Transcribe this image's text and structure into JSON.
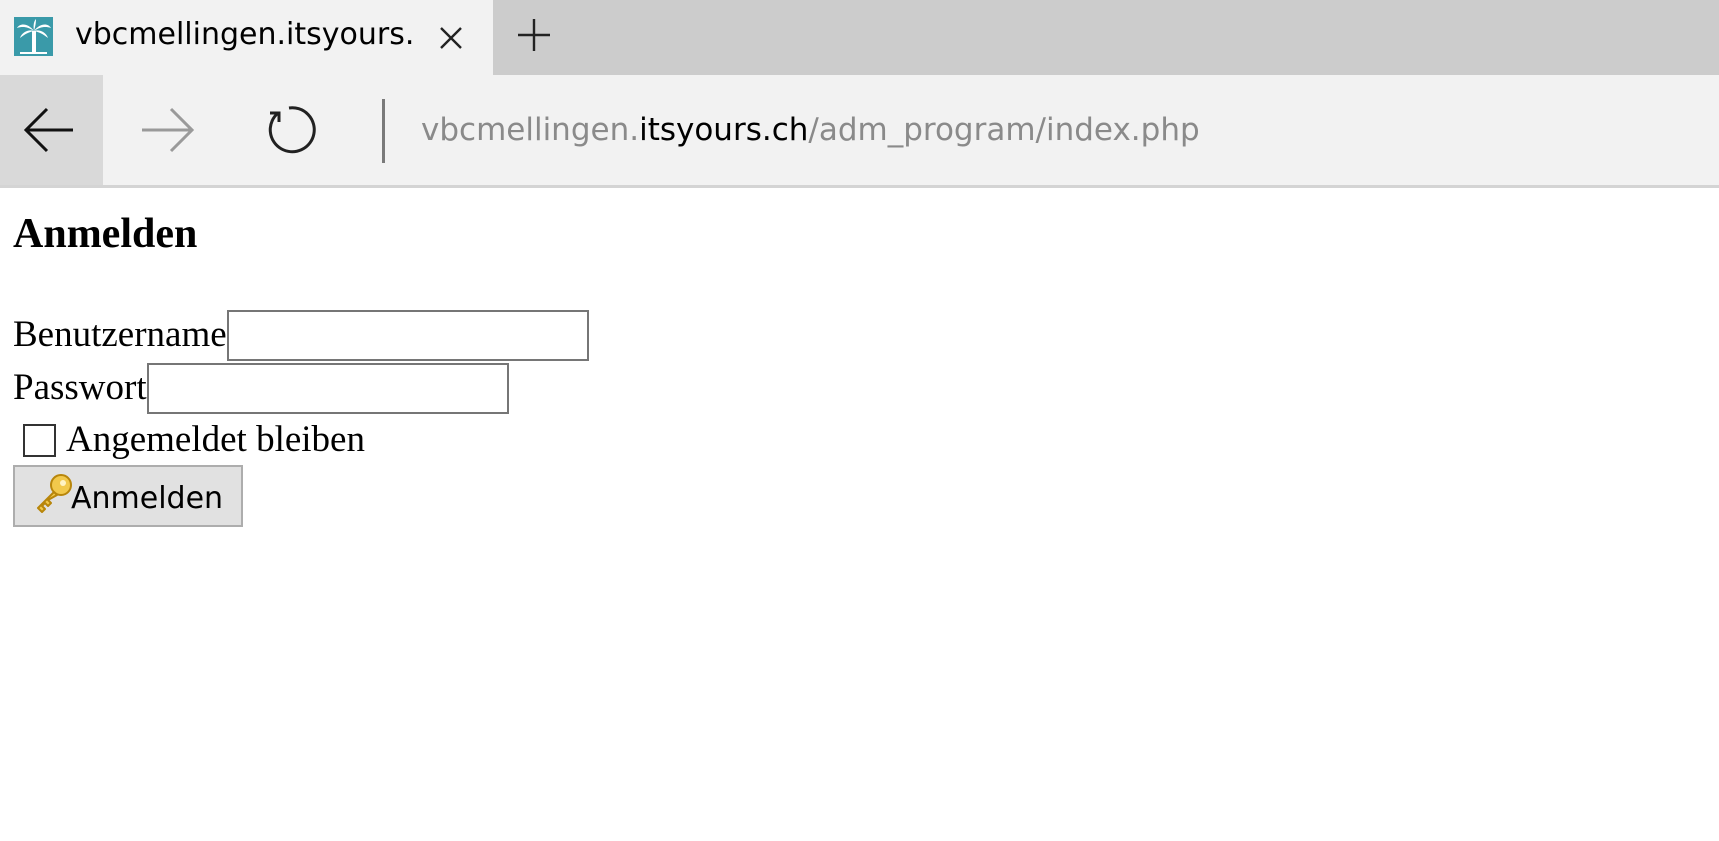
{
  "browser": {
    "tab": {
      "title": "vbcmellingen.itsyours.ch",
      "favicon": "palm-tree-icon"
    },
    "address": {
      "prefix": "vbcmellingen.",
      "host": "itsyours.ch",
      "path": "/adm_program/index.php"
    },
    "icons": {
      "back": "arrow-left-icon",
      "forward": "arrow-right-icon",
      "refresh": "refresh-icon",
      "close": "close-icon",
      "new_tab": "plus-icon"
    }
  },
  "page": {
    "title": "Anmelden",
    "username_label": "Benutzername",
    "username_value": "",
    "password_label": "Passwort",
    "password_value": "",
    "remember_label": "Angemeldet bleiben",
    "remember_checked": false,
    "submit_label": "Anmelden",
    "submit_icon": "key-icon"
  },
  "colors": {
    "tabstrip_bg": "#cccccc",
    "active_tab_bg": "#f2f2f2",
    "favicon_teal": "#3a9aa9",
    "url_muted": "#8a8a8a",
    "button_bg": "#e1e1e1"
  }
}
